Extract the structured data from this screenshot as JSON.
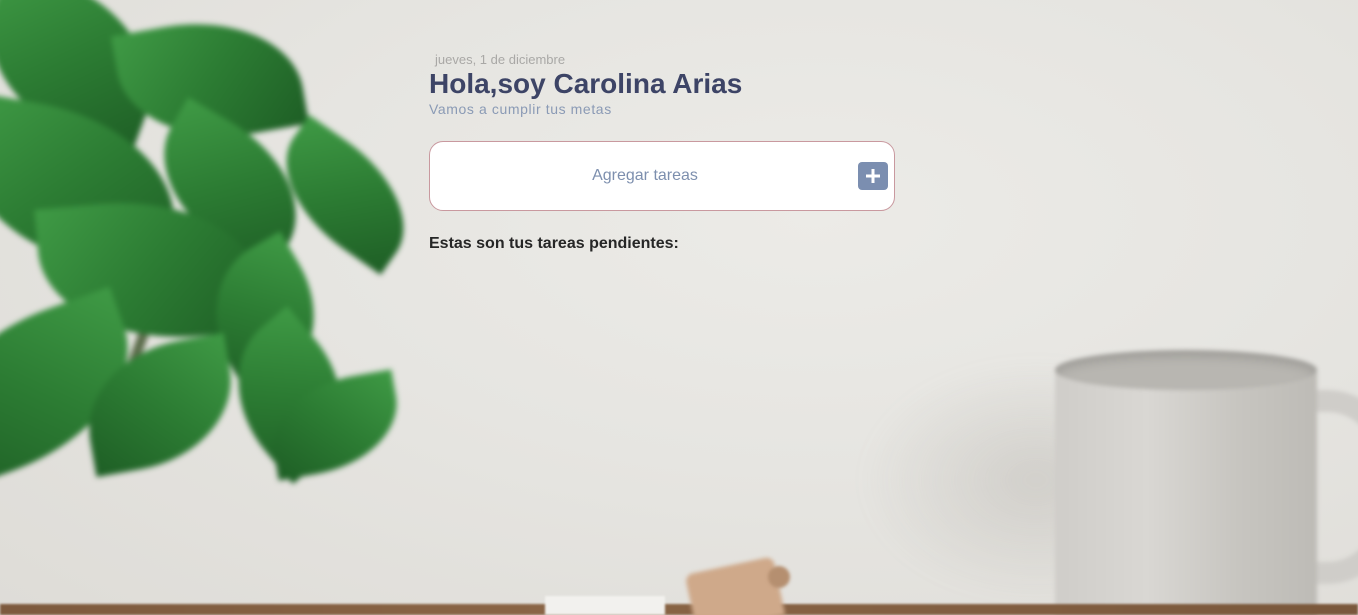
{
  "header": {
    "date": "jueves, 1 de diciembre",
    "greeting": "Hola,soy Carolina Arias",
    "subtitle": "Vamos a cumplir tus metas"
  },
  "task_input": {
    "placeholder": "Agregar tareas",
    "value": "",
    "add_button_icon": "plus-icon"
  },
  "tasks": {
    "heading": "Estas son tus tareas pendientes:",
    "items": []
  },
  "colors": {
    "title": "#3d4466",
    "subtitle": "#8a9ab5",
    "accent_button": "#7b8eb0",
    "input_border": "#c9999f"
  }
}
